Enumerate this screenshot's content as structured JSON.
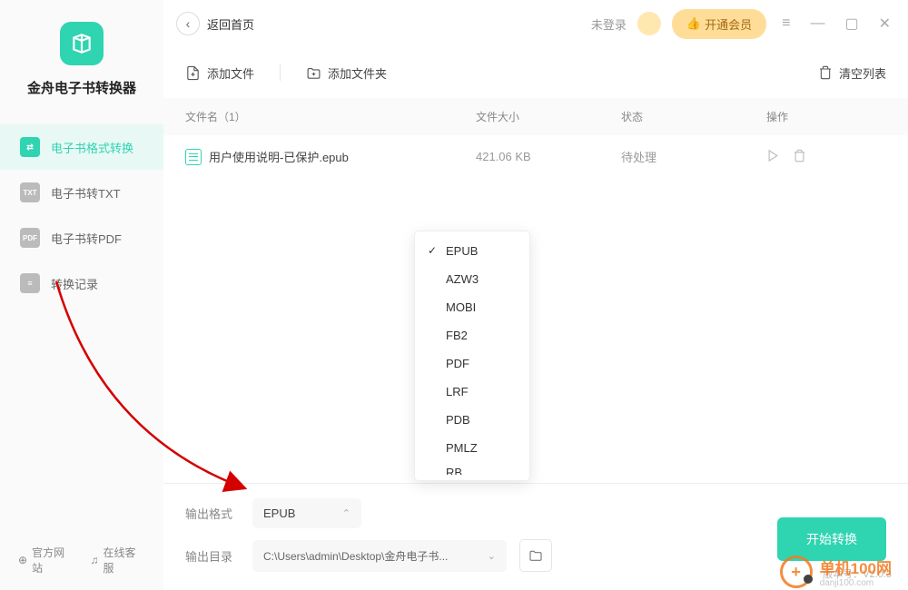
{
  "app_name": "金舟电子书转换器",
  "header": {
    "back": "返回首页",
    "login": "未登录",
    "vip": "开通会员"
  },
  "sidebar": {
    "items": [
      {
        "label": "电子书格式转换",
        "icon": "≡"
      },
      {
        "label": "电子书转TXT",
        "icon": "TXT"
      },
      {
        "label": "电子书转PDF",
        "icon": "PDF"
      },
      {
        "label": "转换记录",
        "icon": "≡"
      }
    ]
  },
  "footer": {
    "website": "官方网站",
    "support": "在线客服"
  },
  "toolbar": {
    "add_file": "添加文件",
    "add_folder": "添加文件夹",
    "clear": "清空列表"
  },
  "table": {
    "headers": {
      "name": "文件名（1）",
      "size": "文件大小",
      "status": "状态",
      "action": "操作"
    },
    "rows": [
      {
        "name": "用户使用说明-已保护.epub",
        "size": "421.06 KB",
        "status": "待处理"
      }
    ]
  },
  "bottom": {
    "format_label": "输出格式",
    "format_value": "EPUB",
    "dir_label": "输出目录",
    "dir_value": "C:\\Users\\admin\\Desktop\\金舟电子书...",
    "start": "开始转换"
  },
  "dropdown": {
    "options": [
      "EPUB",
      "AZW3",
      "MOBI",
      "FB2",
      "PDF",
      "LRF",
      "PDB",
      "PMLZ",
      "RB"
    ]
  },
  "version": "版本号：V2.0.3",
  "watermark": {
    "name": "单机100网",
    "sub": "danji100.com"
  }
}
